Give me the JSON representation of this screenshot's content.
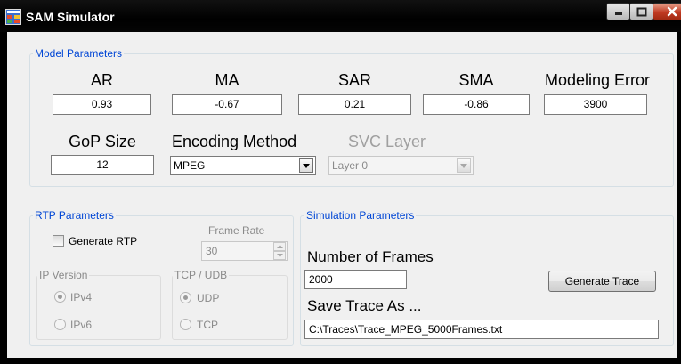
{
  "window": {
    "title": "SAM Simulator",
    "icon": "app-window-icon"
  },
  "model": {
    "legend": "Model Parameters",
    "ar": {
      "label": "AR",
      "value": "0.93"
    },
    "ma": {
      "label": "MA",
      "value": "-0.67"
    },
    "sar": {
      "label": "SAR",
      "value": "0.21"
    },
    "sma": {
      "label": "SMA",
      "value": "-0.86"
    },
    "error": {
      "label": "Modeling Error",
      "value": "3900"
    },
    "gop": {
      "label": "GoP Size",
      "value": "12"
    },
    "encoding": {
      "label": "Encoding Method",
      "value": "MPEG"
    },
    "svc": {
      "label": "SVC Layer",
      "value": "Layer 0"
    }
  },
  "rtp": {
    "legend": "RTP Parameters",
    "generate_label": "Generate RTP",
    "frame_rate_label": "Frame Rate",
    "frame_rate_value": "30",
    "ip_version": {
      "legend": "IP Version",
      "options": [
        "IPv4",
        "IPv6"
      ],
      "selected": "IPv4"
    },
    "transport": {
      "legend": "TCP / UDB",
      "options": [
        "UDP",
        "TCP"
      ],
      "selected": "UDP"
    }
  },
  "simulation": {
    "legend": "Simulation Parameters",
    "frames_label": "Number of Frames",
    "frames_value": "2000",
    "generate_button": "Generate Trace",
    "save_label": "Save Trace As ...",
    "save_path": "C:\\Traces\\Trace_MPEG_5000Frames.txt"
  },
  "colors": {
    "legend_blue": "#0046d5",
    "disabled_gray": "#8a8a8a",
    "client_bg": "#f0f0f0"
  }
}
